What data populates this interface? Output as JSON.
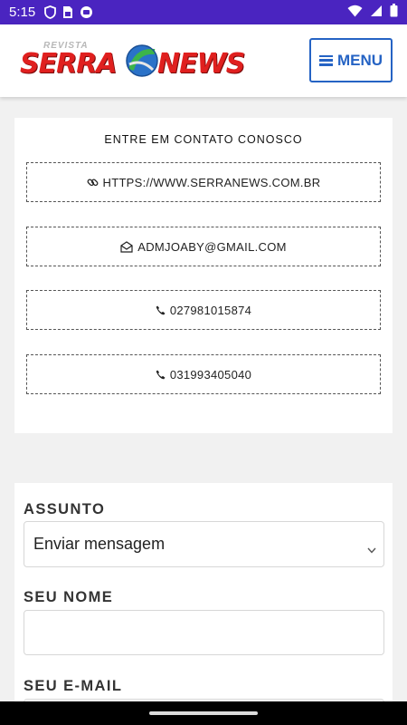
{
  "status_bar": {
    "time": "5:15",
    "left_icons": [
      "shield-icon",
      "sim-card-icon",
      "app-icon"
    ],
    "right_icons": [
      "wifi-icon",
      "signal-icon",
      "battery-icon"
    ]
  },
  "header": {
    "logo": {
      "small": "REVISTA",
      "word1": "SERRA",
      "word2": "NEWS"
    },
    "menu_label": "MENU",
    "colors": {
      "accent": "#2563c4",
      "logo_red": "#e0201f"
    }
  },
  "contact": {
    "title": "ENTRE EM CONTATO CONOSCO",
    "items": [
      {
        "icon": "link-icon",
        "text": "HTTPS://WWW.SERRANEWS.COM.BR"
      },
      {
        "icon": "envelope-open-icon",
        "text": "ADMJOABY@GMAIL.COM"
      },
      {
        "icon": "phone-icon",
        "text": "027981015874"
      },
      {
        "icon": "phone-icon",
        "text": "031993405040"
      }
    ]
  },
  "form": {
    "subject_label": "ASSUNTO",
    "subject_value": "Enviar mensagem",
    "name_label": "SEU NOME",
    "name_value": "",
    "email_label": "SEU E-MAIL",
    "email_value": ""
  }
}
